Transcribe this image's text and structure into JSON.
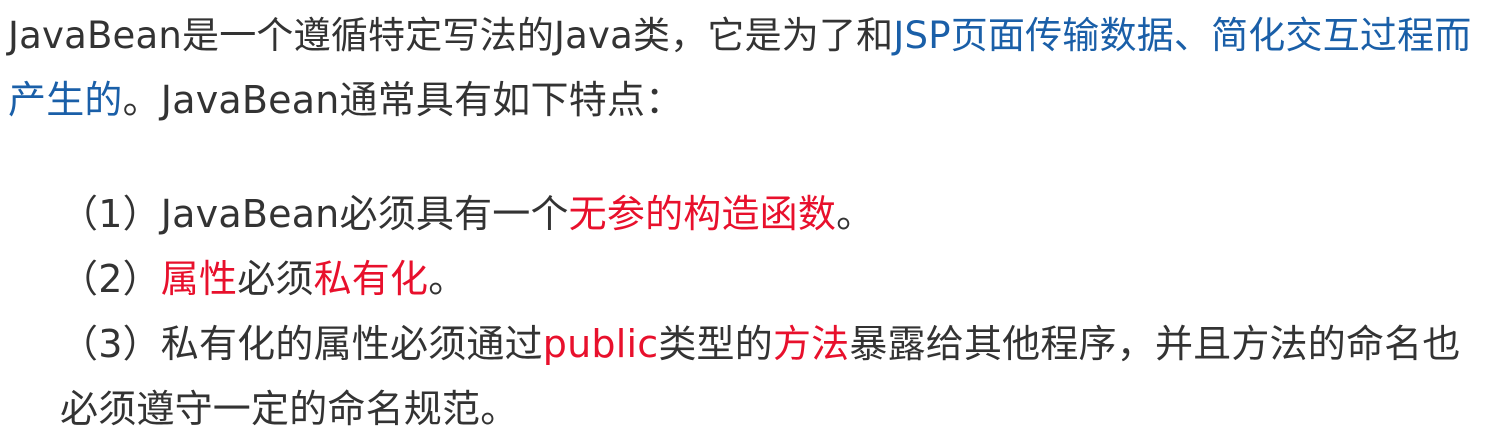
{
  "colors": {
    "text": "#333333",
    "link_blue": "#1a5fa8",
    "highlight_red": "#e8102c"
  },
  "intro": {
    "line1_plain": "JavaBean是一个遵循特定写法的Java类，它是为了和",
    "line1_blue": "JSP页面传输数据、简化交互过程而",
    "line2_blue": "产生的",
    "line2_plain": "。JavaBean通常具有如下特点："
  },
  "points": [
    {
      "prefix": "（1）JavaBean必须具有一个",
      "highlight": "无参的构造函数",
      "suffix": "。"
    },
    {
      "prefix": "（2）",
      "highlight1": "属性",
      "middle": "必须",
      "highlight2": "私有化",
      "suffix": "。"
    },
    {
      "prefix": "（3）私有化的属性必须通过",
      "highlight1": "public",
      "middle1": "类型的",
      "highlight2": "方法",
      "middle2": "暴露给其他程序，并且方法的命名也",
      "continuation": "必须遵守一定的命名规范。"
    }
  ]
}
